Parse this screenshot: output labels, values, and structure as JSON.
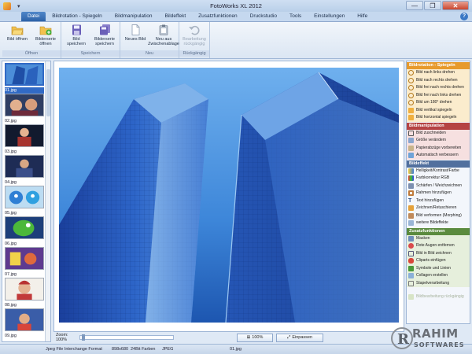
{
  "window": {
    "title": "FotoWorks XL 2012",
    "buttons": {
      "minimize": "—",
      "maximize": "❐",
      "close": "✕"
    }
  },
  "tabs": [
    "Datei",
    "Bildrotation - Spiegeln",
    "Bildmanipulation",
    "Bildeffekt",
    "Zusatzfunktionen",
    "Druckstudio",
    "Tools",
    "Einstellungen",
    "Hilfe"
  ],
  "ribbon": {
    "groups": [
      {
        "label": "Öffnen",
        "buttons": [
          {
            "label": "Bild öffnen",
            "icon": "folder-open-icon"
          },
          {
            "label": "Bilderserie öffnen",
            "icon": "folder-plus-icon"
          }
        ]
      },
      {
        "label": "Speichern",
        "buttons": [
          {
            "label": "Bild speichern",
            "icon": "floppy-icon"
          },
          {
            "label": "Bilderserie speichern",
            "icon": "floppy-multi-icon"
          }
        ]
      },
      {
        "label": "Neu",
        "buttons": [
          {
            "label": "Neues Bild",
            "icon": "new-image-icon"
          },
          {
            "label": "Neu aus Zwischenablage",
            "icon": "clipboard-icon"
          }
        ]
      },
      {
        "label": "Rückgängig",
        "buttons": [
          {
            "label": "Bearbeitung rückgängig",
            "icon": "undo-icon",
            "disabled": true
          }
        ]
      }
    ]
  },
  "thumbnails": [
    {
      "name": "01.jpg",
      "selected": true
    },
    {
      "name": "02.jpg"
    },
    {
      "name": "03.jpg"
    },
    {
      "name": "04.jpg"
    },
    {
      "name": "05.jpg"
    },
    {
      "name": "06.jpg"
    },
    {
      "name": "07.jpg"
    },
    {
      "name": "08.jpg"
    },
    {
      "name": "09.jpg"
    }
  ],
  "zoom": {
    "label": "Zoom: 100%",
    "btn_100": "100%",
    "btn_fit": "Einpassen"
  },
  "right_panel": {
    "sections": [
      {
        "title": "Bildrotation - Spiegeln",
        "color": "orange",
        "items": [
          "Bild nach links drehen",
          "Bild nach rechts drehen",
          "Bild frei nach rechts drehen",
          "Bild frei nach links drehen",
          "Bild um 180° drehen",
          "Bild vertikal spiegeln",
          "Bild horizontal spiegeln"
        ]
      },
      {
        "title": "Bildmanipulation",
        "color": "red",
        "items": [
          "Bild zuschneiden",
          "Größe verändern",
          "Papierabzüge vorbereiten",
          "Automatisch verbessern"
        ]
      },
      {
        "title": "Bildeffekt",
        "color": "blue",
        "items": [
          "Helligkeit/Kontrast/Farbe",
          "Farbkorrektur RGB",
          "Schärfen / Weichzeichnen",
          "Rahmen hinzufügen",
          "Text hinzufügen",
          "Zeichnen/Retuschieren",
          "Bild verformen (Morphing)",
          "weitere Bildeffekte"
        ]
      },
      {
        "title": "Zusatzfunktionen",
        "color": "green",
        "items": [
          "Masken",
          "Rote Augen entfernen",
          "Bild in Bild zeichnen",
          "Cliparts einfügen",
          "Symbole und Linien",
          "Collagen erstellen",
          "Stapelverarbeitung"
        ]
      }
    ],
    "footer": "Bildbearbeitung rückgängig"
  },
  "status": {
    "format": "Jpeg File Interchange Format",
    "dimensions": "898x680",
    "colors": "24Bit Farben",
    "type": "JPEG",
    "filename": "01.jpg"
  },
  "watermark": {
    "line1": "RAHIM",
    "line2": "SOFTWARES"
  }
}
